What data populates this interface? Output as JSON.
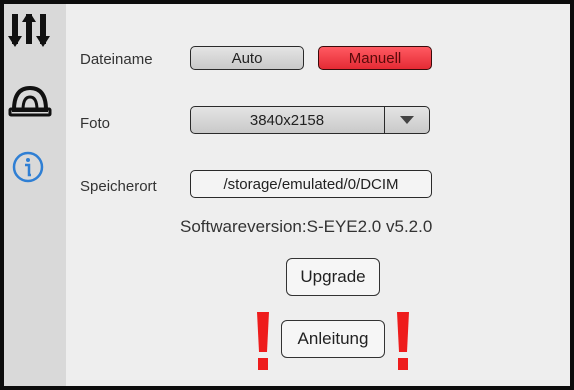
{
  "sidebar": {
    "items": [
      {
        "icon": "settings-sliders-icon"
      },
      {
        "icon": "helmet-icon"
      },
      {
        "icon": "info-icon"
      }
    ]
  },
  "filename": {
    "label": "Dateiname",
    "option_auto": "Auto",
    "option_manual": "Manuell",
    "selected": "Manuell"
  },
  "photo": {
    "label": "Foto",
    "resolution": "3840x2158"
  },
  "storage": {
    "label": "Speicherort",
    "path": "/storage/emulated/0/DCIM"
  },
  "software": {
    "version_text": "Softwareversion:S-EYE2.0 v5.2.0"
  },
  "buttons": {
    "upgrade": "Upgrade",
    "manual": "Anleitung"
  },
  "colors": {
    "accent_red": "#e52a34",
    "info_blue": "#2f7fd4",
    "exclamation_red": "#ee1c1c"
  }
}
